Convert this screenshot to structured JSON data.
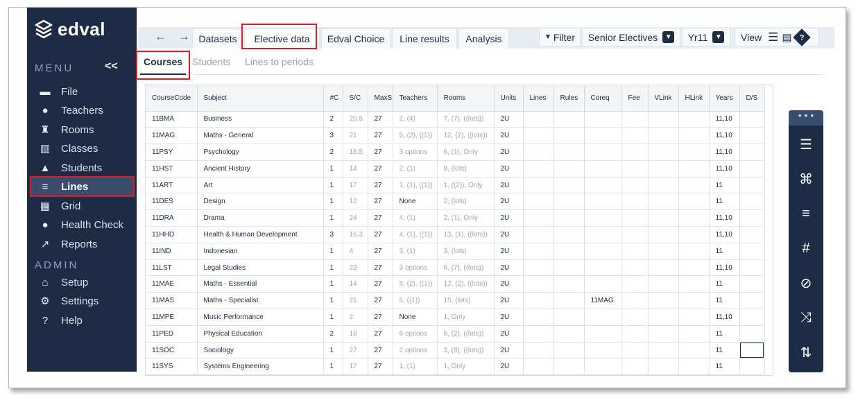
{
  "app": {
    "logo_text": "edval"
  },
  "sidebar": {
    "menu_label": "MENU",
    "collapse_label": "<<",
    "admin_label": "ADMIN",
    "items": [
      {
        "label": "File",
        "icon": "folder-icon"
      },
      {
        "label": "Teachers",
        "icon": "person-icon"
      },
      {
        "label": "Rooms",
        "icon": "chair-icon"
      },
      {
        "label": "Classes",
        "icon": "book-icon"
      },
      {
        "label": "Students",
        "icon": "graduation-cap-icon"
      },
      {
        "label": "Lines",
        "icon": "lines-icon"
      },
      {
        "label": "Grid",
        "icon": "grid-icon"
      },
      {
        "label": "Health Check",
        "icon": "apple-icon"
      },
      {
        "label": "Reports",
        "icon": "chart-line-icon"
      }
    ],
    "admin_items": [
      {
        "label": "Setup",
        "icon": "home-icon"
      },
      {
        "label": "Settings",
        "icon": "gear-icon"
      },
      {
        "label": "Help",
        "icon": "help-bubble-icon"
      }
    ]
  },
  "topbar": {
    "nav_arrows": "← →",
    "tabs": [
      "Datasets",
      "Elective data",
      "Edval Choice",
      "Line results",
      "Analysis"
    ],
    "filter_label": "Filter",
    "filter_value": "Senior Electives",
    "year_value": "Yr11",
    "view_label": "View"
  },
  "subtabs": [
    "Courses",
    "Students",
    "Lines to periods"
  ],
  "table": {
    "columns": [
      "CourseCode",
      "Subject",
      "#C",
      "S/C",
      "MaxS",
      "Teachers",
      "Rooms",
      "Units",
      "Lines",
      "Rules",
      "Coreq",
      "Fee",
      "VLink",
      "HLink",
      "Years",
      "D/S"
    ],
    "rows": [
      [
        "11BMA",
        "Business",
        "2",
        "20.5",
        "27",
        "2, (4)",
        "7, (7), ((lots))",
        "2U",
        "",
        "",
        "",
        "",
        "",
        "",
        "11,10",
        ""
      ],
      [
        "11MAG",
        "Maths - General",
        "3",
        "21",
        "27",
        "5, (2), ((1))",
        "12, (2), ((lots))",
        "2U",
        "",
        "",
        "",
        "",
        "",
        "",
        "11,10",
        ""
      ],
      [
        "11PSY",
        "Psychology",
        "2",
        "18.5",
        "27",
        "3 options",
        "6, (1), Only",
        "2U",
        "",
        "",
        "",
        "",
        "",
        "",
        "11,10",
        ""
      ],
      [
        "11HST",
        "Ancient History",
        "1",
        "14",
        "27",
        "2, (1)",
        "8, (lots)",
        "2U",
        "",
        "",
        "",
        "",
        "",
        "",
        "11,10",
        ""
      ],
      [
        "11ART",
        "Art",
        "1",
        "17",
        "27",
        "1, (1), ((1))",
        "1, ((2)), Only",
        "2U",
        "",
        "",
        "",
        "",
        "",
        "",
        "11",
        ""
      ],
      [
        "11DES",
        "Design",
        "1",
        "12",
        "27",
        "None",
        "2, (lots)",
        "2U",
        "",
        "",
        "",
        "",
        "",
        "",
        "11",
        ""
      ],
      [
        "11DRA",
        "Drama",
        "1",
        "24",
        "27",
        "4, (1)",
        "2, (1), Only",
        "2U",
        "",
        "",
        "",
        "",
        "",
        "",
        "11,10",
        ""
      ],
      [
        "11HHD",
        "Health & Human Development",
        "3",
        "16.3",
        "27",
        "4, (1), ((1))",
        "13, (1), ((lots))",
        "2U",
        "",
        "",
        "",
        "",
        "",
        "",
        "11,10",
        ""
      ],
      [
        "11IND",
        "Indonesian",
        "1",
        "4",
        "27",
        "3, (1)",
        "3, (lots)",
        "2U",
        "",
        "",
        "",
        "",
        "",
        "",
        "11",
        ""
      ],
      [
        "11LST",
        "Legal Studies",
        "1",
        "23",
        "27",
        "3 options",
        "6, (7), ((lots))",
        "2U",
        "",
        "",
        "",
        "",
        "",
        "",
        "11,10",
        ""
      ],
      [
        "11MAE",
        "Maths - Essential",
        "1",
        "14",
        "27",
        "5, (2), ((1))",
        "12, (2), ((lots))",
        "2U",
        "",
        "",
        "",
        "",
        "",
        "",
        "11",
        ""
      ],
      [
        "11MAS",
        "Maths - Specialist",
        "1",
        "21",
        "27",
        "5, ((1))",
        "15, (lots)",
        "2U",
        "",
        "",
        "11MAG",
        "",
        "",
        "",
        "11",
        ""
      ],
      [
        "11MPE",
        "Music Performance",
        "1",
        "2",
        "27",
        "None",
        "1, Only",
        "2U",
        "",
        "",
        "",
        "",
        "",
        "",
        "11,10",
        ""
      ],
      [
        "11PED",
        "Physical Education",
        "2",
        "18",
        "27",
        "6 options",
        "6, (2), ((lots))",
        "2U",
        "",
        "",
        "",
        "",
        "",
        "",
        "11",
        ""
      ],
      [
        "11SOC",
        "Sociology",
        "1",
        "27",
        "27",
        "2 options",
        "3, (8), ((lots))",
        "2U",
        "",
        "",
        "",
        "",
        "",
        "",
        "11",
        ""
      ],
      [
        "11SYS",
        "Systems Engineering",
        "1",
        "17",
        "27",
        "1, (1)",
        "1, Only",
        "2U",
        "",
        "",
        "",
        "",
        "",
        "",
        "11",
        ""
      ]
    ]
  },
  "rightbar": {
    "dots": "• • •",
    "icons": [
      "sliders-icon",
      "command-icon",
      "sort-refresh-icon",
      "hash-icon",
      "no-entry-icon",
      "shuffle-icon",
      "swap-icon"
    ],
    "glyphs": [
      "☰",
      "⌘",
      "≡",
      "#",
      "⊘",
      "⤨",
      "⇅"
    ]
  }
}
